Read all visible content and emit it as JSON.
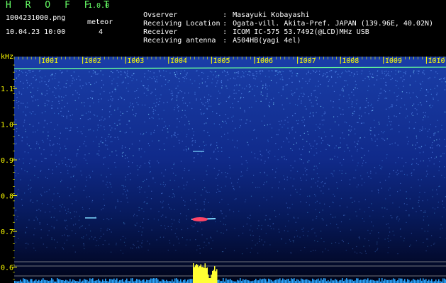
{
  "header": {
    "app_title": "H R O F F T",
    "app_version": "1.0.0",
    "filename": "1004231000.png",
    "datetime": "10.04.23 10:00",
    "meteor_label": "meteor",
    "meteor_count": "4",
    "info": [
      {
        "key": "Ovserver",
        "value": "Masayuki Kobayashi"
      },
      {
        "key": "Receiving Location",
        "value": "Ogata-vill. Akita-Pref. JAPAN (139.96E, 40.02N)"
      },
      {
        "key": "Receiver",
        "value": "ICOM IC-575 53.7492(@LCD)MHz USB"
      },
      {
        "key": "Receiving antenna",
        "value": "A504HB(yagi 4el)"
      }
    ]
  },
  "spectrogram": {
    "unit_label": "kHz",
    "y_ticks": [
      "1.1",
      "1.0",
      "0.9",
      "0.8",
      "0.7",
      "0.6"
    ],
    "time_ticks": [
      "1001",
      "1002",
      "1003",
      "1004",
      "1005",
      "1006",
      "1007",
      "1008",
      "1009",
      "1010"
    ],
    "colors": {
      "label": "#ffff00",
      "carrier": "#66ff99",
      "meteor": "#ff4466",
      "burst": "#ffff33",
      "baseline": "#2aa6ff"
    }
  }
}
